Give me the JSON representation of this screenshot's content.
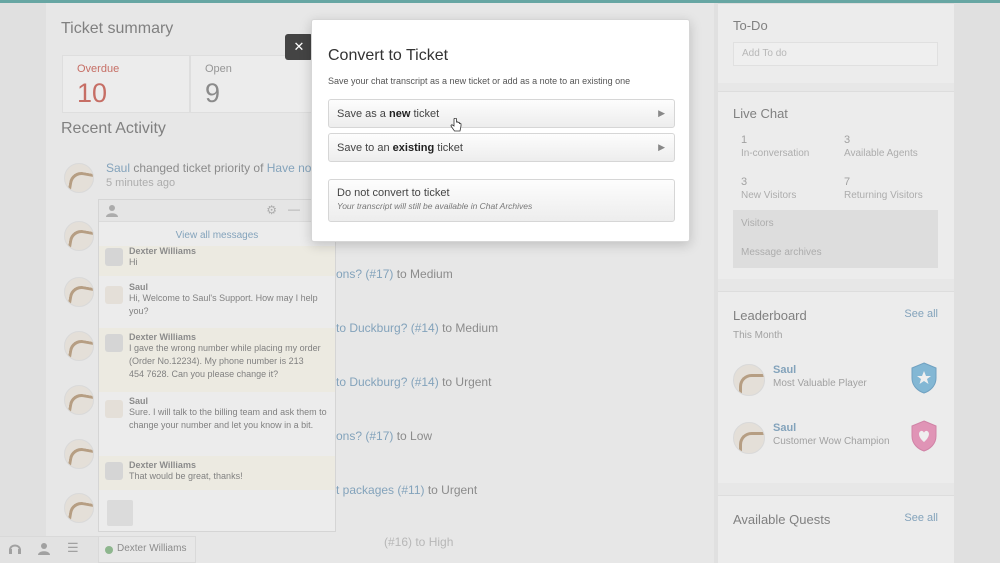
{
  "ticket_summary": {
    "title": "Ticket summary",
    "overdue_label": "Overdue",
    "overdue_count": "10",
    "open_label": "Open",
    "open_count": "9"
  },
  "recent_activity": {
    "title": "Recent Activity",
    "rows": [
      {
        "who": "Saul",
        "action": " changed ticket priority of ",
        "link": "Have not",
        "suffix": "",
        "time": "5 minutes ago"
      },
      {
        "who": "",
        "action": "",
        "link": "",
        "suffix": "",
        "time": ""
      },
      {
        "who": "",
        "action": "",
        "link": "ons? (#17)",
        "suffix": " to Medium",
        "time": ""
      },
      {
        "who": "",
        "action": "",
        "link": "to Duckburg? (#14)",
        "suffix": " to Medium",
        "time": ""
      },
      {
        "who": "",
        "action": "",
        "link": "to Duckburg? (#14)",
        "suffix": " to Urgent",
        "time": ""
      },
      {
        "who": "",
        "action": "",
        "link": "ons? (#17)",
        "suffix": " to Low",
        "time": ""
      },
      {
        "who": "",
        "action": "",
        "link": "t packages (#11)",
        "suffix": " to Urgent",
        "time": ""
      },
      {
        "who": "",
        "action": "",
        "link": "",
        "suffix": "(#16) to High",
        "time": ""
      }
    ]
  },
  "todo": {
    "title": "To-Do",
    "placeholder": "Add To do"
  },
  "live_chat": {
    "title": "Live Chat",
    "stats": [
      {
        "count": "1",
        "label": "In-conversation"
      },
      {
        "count": "3",
        "label": "Available Agents"
      },
      {
        "count": "3",
        "label": "New Visitors"
      },
      {
        "count": "7",
        "label": "Returning Visitors"
      }
    ],
    "links": [
      "Visitors",
      "Message archives"
    ]
  },
  "leaderboard": {
    "title": "Leaderboard",
    "see_all": "See all",
    "period": "This Month",
    "entries": [
      {
        "name": "Saul",
        "title": "Most Valuable Player"
      },
      {
        "name": "Saul",
        "title": "Customer Wow Champion"
      }
    ]
  },
  "quests": {
    "title": "Available Quests",
    "see_all": "See all"
  },
  "chat_widget": {
    "view_all": "View all messages",
    "messages": [
      {
        "sender": "Dexter Williams",
        "text": "Hi",
        "role": "visitor"
      },
      {
        "sender": "Saul",
        "text": "Hi, Welcome to Saul's Support. How may I help you?",
        "role": "agent"
      },
      {
        "sender": "Dexter Williams",
        "text": "I gave the wrong number while placing my order (Order No.12234). My phone number is 213 454 7628. Can you please change it?",
        "role": "visitor"
      },
      {
        "sender": "Saul",
        "text": "Sure. I will talk to the billing team and ask them to change your number and let you know in a bit.",
        "role": "agent"
      },
      {
        "sender": "Dexter Williams",
        "text": "That would be great, thanks!",
        "role": "visitor"
      }
    ],
    "visitor_tab": "Dexter Williams"
  },
  "modal": {
    "close": "✕",
    "title": "Convert to Ticket",
    "subtitle": "Save your chat transcript as a new ticket or add as a note to an existing one",
    "option_new_pre": "Save as a ",
    "option_new_bold": "new",
    "option_new_post": " ticket",
    "option_existing_pre": "Save to an ",
    "option_existing_bold": "existing",
    "option_existing_post": " ticket",
    "option_none": "Do not convert to ticket",
    "option_none_hint": "Your transcript will still be available in Chat Archives"
  },
  "colors": {
    "accent": "#2e8f8a",
    "link": "#5a8ab0",
    "overdue": "#c0392b"
  }
}
